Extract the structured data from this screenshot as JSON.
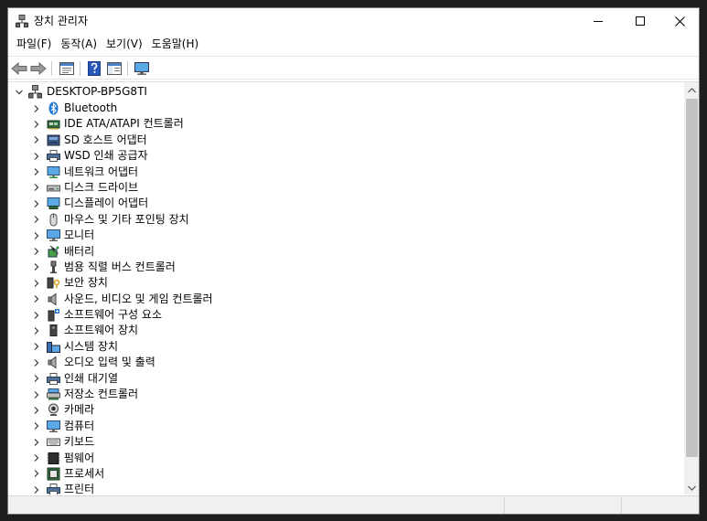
{
  "window": {
    "title": "장치 관리자",
    "controls": {
      "minimize": "minimize-icon",
      "maximize": "maximize-icon",
      "close": "close-icon"
    }
  },
  "menu": [
    {
      "label": "파일(F)"
    },
    {
      "label": "동작(A)"
    },
    {
      "label": "보기(V)"
    },
    {
      "label": "도움말(H)"
    }
  ],
  "toolbar": {
    "buttons": [
      "back-arrow-icon",
      "forward-arrow-icon",
      "properties-icon",
      "help-icon",
      "show-hide-pane-icon",
      "monitor-icon"
    ]
  },
  "tree": {
    "root": {
      "label": "DESKTOP-BP5G8TI",
      "icon": "computer-icon",
      "expanded": true
    },
    "children": [
      {
        "label": "Bluetooth",
        "icon": "bluetooth-icon"
      },
      {
        "label": "IDE ATA/ATAPI 컨트롤러",
        "icon": "ide-controller-icon"
      },
      {
        "label": "SD 호스트 어댑터",
        "icon": "sd-host-icon"
      },
      {
        "label": "WSD 인쇄 공급자",
        "icon": "printer-icon"
      },
      {
        "label": "네트워크 어댑터",
        "icon": "network-adapter-icon"
      },
      {
        "label": "디스크 드라이브",
        "icon": "disk-drive-icon"
      },
      {
        "label": "디스플레이 어댑터",
        "icon": "display-adapter-icon"
      },
      {
        "label": "마우스 및 기타 포인팅 장치",
        "icon": "mouse-icon"
      },
      {
        "label": "모니터",
        "icon": "monitor-icon"
      },
      {
        "label": "배터리",
        "icon": "battery-icon"
      },
      {
        "label": "범용 직렬 버스 컨트롤러",
        "icon": "usb-icon"
      },
      {
        "label": "보안 장치",
        "icon": "security-device-icon"
      },
      {
        "label": "사운드, 비디오 및 게임 컨트롤러",
        "icon": "speaker-icon"
      },
      {
        "label": "소프트웨어 구성 요소",
        "icon": "software-component-icon"
      },
      {
        "label": "소프트웨어 장치",
        "icon": "software-device-icon"
      },
      {
        "label": "시스템 장치",
        "icon": "system-device-icon"
      },
      {
        "label": "오디오 입력 및 출력",
        "icon": "speaker-icon"
      },
      {
        "label": "인쇄 대기열",
        "icon": "printer-icon"
      },
      {
        "label": "저장소 컨트롤러",
        "icon": "storage-controller-icon"
      },
      {
        "label": "카메라",
        "icon": "camera-icon"
      },
      {
        "label": "컴퓨터",
        "icon": "monitor-icon"
      },
      {
        "label": "키보드",
        "icon": "keyboard-icon"
      },
      {
        "label": "펌웨어",
        "icon": "firmware-icon"
      },
      {
        "label": "프로세서",
        "icon": "processor-icon"
      },
      {
        "label": "프린터",
        "icon": "printer-icon"
      }
    ]
  },
  "colors": {
    "selection": "#cce8ff",
    "scroll_thumb": "#c2c2c2",
    "accent_blue": "#1e78d2"
  }
}
